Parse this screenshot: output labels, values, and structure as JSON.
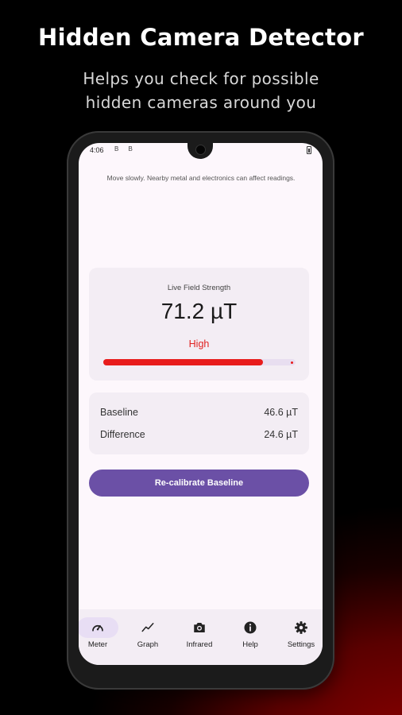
{
  "promo": {
    "title": "Hidden Camera Detector",
    "subtitle_line1": "Helps you check for possible",
    "subtitle_line2": "hidden cameras around you"
  },
  "status_bar": {
    "time": "4:06",
    "icons": "B B"
  },
  "screen": {
    "hint": "Move slowly. Nearby metal and electronics can affect readings."
  },
  "field_card": {
    "label": "Live Field Strength",
    "value": "71.2 µT",
    "level": "High",
    "progress_fraction": 0.83,
    "level_color": "#e02020"
  },
  "baseline_card": {
    "baseline_label": "Baseline",
    "baseline_value": "46.6 µT",
    "difference_label": "Difference",
    "difference_value": "24.6 µT"
  },
  "recalibrate_button": {
    "label": "Re-calibrate Baseline",
    "color": "#6b50a6"
  },
  "bottom_nav": {
    "active": "Meter",
    "items": [
      {
        "label": "Meter",
        "icon": "speedometer-icon"
      },
      {
        "label": "Graph",
        "icon": "trend-line-icon"
      },
      {
        "label": "Infrared",
        "icon": "camera-icon"
      },
      {
        "label": "Help",
        "icon": "info-icon"
      },
      {
        "label": "Settings",
        "icon": "gear-icon"
      }
    ]
  }
}
